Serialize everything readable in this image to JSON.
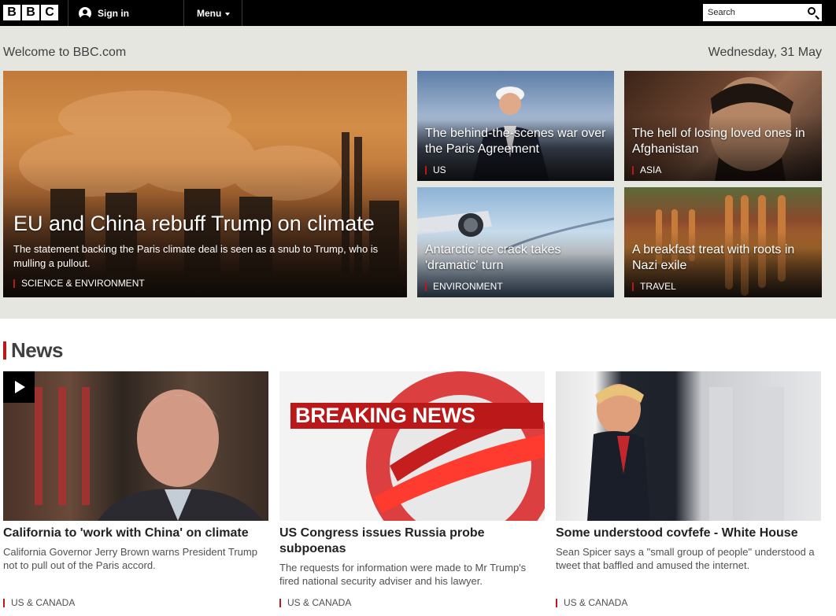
{
  "header": {
    "logo": [
      "B",
      "B",
      "C"
    ],
    "sign_in": "Sign in",
    "menu": "Menu",
    "search_placeholder": "Search"
  },
  "welcome": "Welcome to BBC.com",
  "date": "Wednesday, 31 May",
  "hero": {
    "main": {
      "title": "EU and China rebuff Trump on climate",
      "summary": "The statement backing the Paris climate deal is seen as a snub to Trump, who is mulling a pullout.",
      "tag": "SCIENCE & ENVIRONMENT"
    },
    "tiles": [
      {
        "title": "The behind-the-scenes war over the Paris Agreement",
        "tag": "US"
      },
      {
        "title": "The hell of losing loved ones in Afghanistan",
        "tag": "ASIA"
      },
      {
        "title": "Antarctic ice crack takes 'dramatic' turn",
        "tag": "ENVIRONMENT"
      },
      {
        "title": "A breakfast treat with roots in Nazi exile",
        "tag": "TRAVEL"
      }
    ]
  },
  "news": {
    "heading": "News",
    "cards": [
      {
        "title": "California to 'work with China' on climate",
        "summary": "California Governor Jerry Brown warns President Trump not to pull out of the Paris accord.",
        "tag": "US & CANADA"
      },
      {
        "title": "US Congress issues Russia probe subpoenas",
        "summary": "The requests for information were made to Mr Trump's fired national security adviser and his lawyer.",
        "tag": "US & CANADA",
        "image_text": "BREAKING NEWS"
      },
      {
        "title": "Some understood covfefe - White House",
        "summary": "Sean Spicer says a \"small group of people\" understood a tweet that baffled and amused the internet.",
        "tag": "US & CANADA"
      }
    ]
  },
  "colors": {
    "accent": "#bb1919",
    "topbar": "#000000",
    "hero_background": "#e6e6e1"
  }
}
